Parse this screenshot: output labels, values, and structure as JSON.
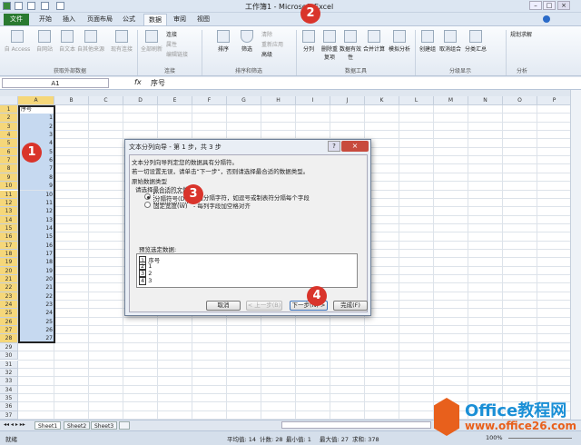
{
  "window": {
    "title": "工作簿1 - Microsoft Excel"
  },
  "tabs": [
    "文件",
    "开始",
    "插入",
    "页面布局",
    "公式",
    "数据",
    "审阅",
    "视图"
  ],
  "ribbon": {
    "get_external": {
      "items": [
        "自 Access",
        "自网站",
        "自文本",
        "自其他来源",
        "现有连接"
      ],
      "label": "获取外部数据"
    },
    "connections": {
      "items": [
        "全部刷新",
        "连接",
        "属性",
        "编辑链接"
      ],
      "label": "连接"
    },
    "sort_filter": {
      "items": [
        "排序",
        "筛选",
        "清除",
        "重新应用",
        "高级"
      ],
      "label": "排序和筛选"
    },
    "data_tools": {
      "items": [
        "分列",
        "删除重复项",
        "数据有效性",
        "合并计算",
        "模拟分析"
      ],
      "label": "数据工具"
    },
    "outline": {
      "items": [
        "创建组",
        "取消组合",
        "分类汇总"
      ],
      "label": "分级显示"
    },
    "analysis": {
      "items": [
        "规划求解"
      ],
      "label": "分析"
    }
  },
  "formula_bar": {
    "name_box": "A1",
    "fx": "fx",
    "value": "序号"
  },
  "columns": [
    "A",
    "B",
    "C",
    "D",
    "E",
    "F",
    "G",
    "H",
    "I",
    "J",
    "K",
    "L",
    "M",
    "N",
    "O",
    "P"
  ],
  "column_a": {
    "header": "序号",
    "values": [
      "1",
      "2",
      "3",
      "4",
      "5",
      "6",
      "7",
      "8",
      "9",
      "10",
      "11",
      "12",
      "13",
      "14",
      "15",
      "16",
      "17",
      "18",
      "19",
      "20",
      "21",
      "22",
      "23",
      "24",
      "25",
      "26",
      "27"
    ]
  },
  "row_count": 37,
  "sheets": [
    "Sheet1",
    "Sheet2",
    "Sheet3"
  ],
  "status": {
    "ready": "就绪",
    "average": "平均值: 14",
    "count": "计数: 28",
    "min": "最小值: 1",
    "max": "最大值: 27",
    "sum": "求和: 378",
    "zoom": "100%"
  },
  "dialog": {
    "title": "文本分列向导 - 第 1 步，共 3 步",
    "line1": "文本分列向导判定您的数据具有分隔符。",
    "line2": "若一切设置无误，请单击“下一步”，否则请选择最合适的数据类型。",
    "section": "原始数据类型",
    "prompt": "请选择最合适的文件类型:",
    "option1": "分隔符号(D)",
    "option1_desc": "- 用分隔字符，如逗号或制表符分隔每个字段",
    "option2": "固定宽度(W)",
    "option2_desc": "- 每列字段加空格对齐",
    "preview_label": "预览选定数据:",
    "preview_rows": [
      [
        "1",
        "序号"
      ],
      [
        "2",
        "1"
      ],
      [
        "3",
        "2"
      ],
      [
        "4",
        "3"
      ]
    ],
    "buttons": {
      "cancel": "取消",
      "back": "< 上一步(B)",
      "next": "下一步(N) >",
      "finish": "完成(F)"
    }
  },
  "badges": [
    "1",
    "2",
    "3",
    "4"
  ],
  "watermark": {
    "name": "Office教程网",
    "url": "www.office26.com"
  },
  "colors": {
    "file_tab": "#2a7a30",
    "selection": "#c6d9f0",
    "badge": "#d9342b",
    "logo": "#e8601c"
  }
}
